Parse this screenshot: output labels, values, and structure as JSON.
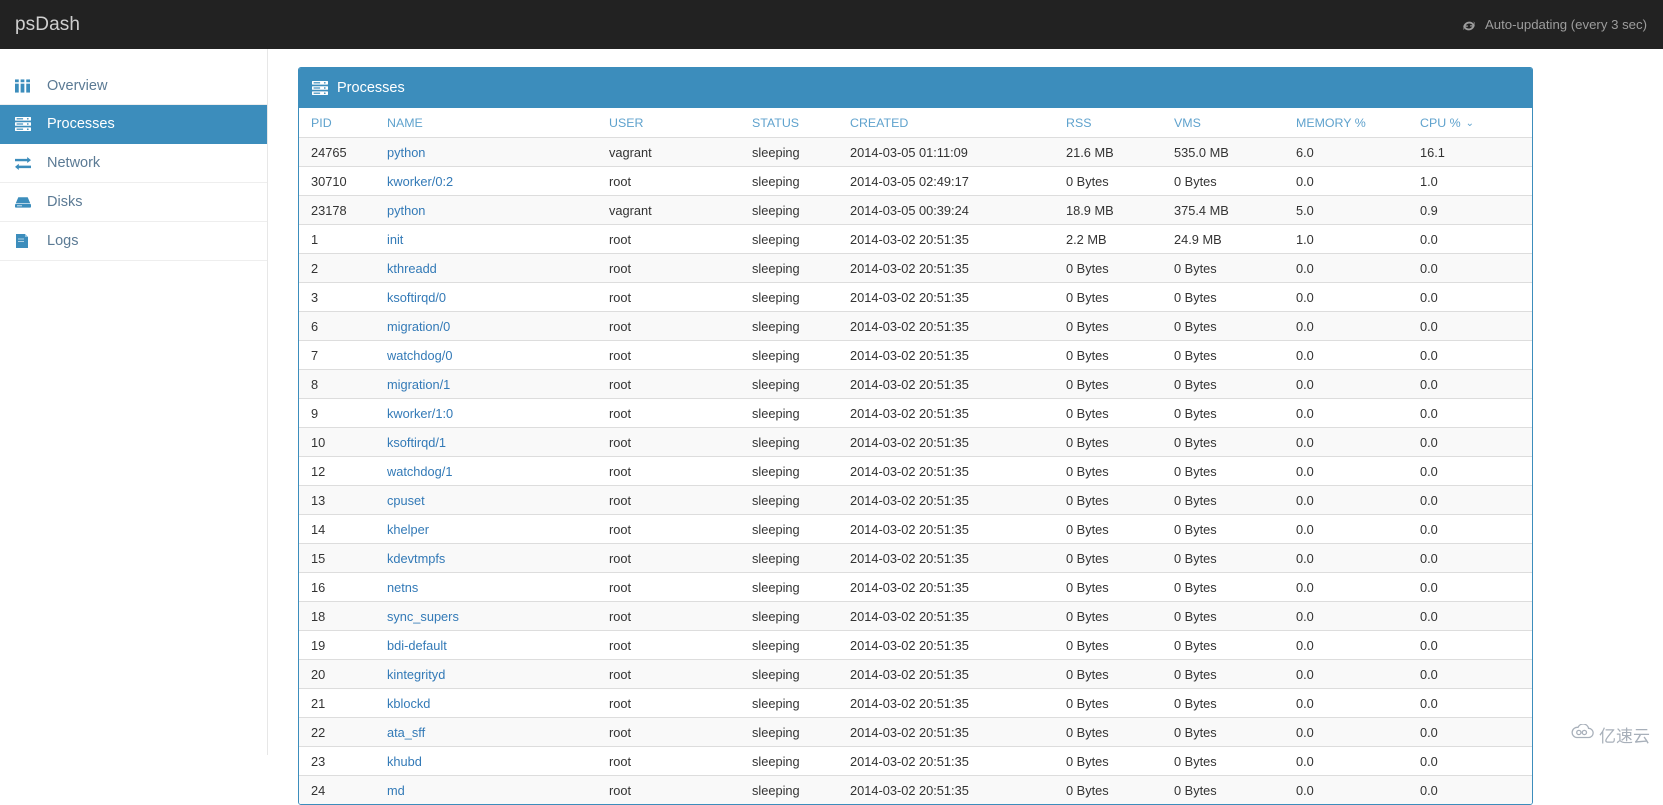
{
  "topbar": {
    "brand": "psDash",
    "refresh_icon": "refresh-icon",
    "auto_update_label": "Auto-updating (every 3 sec)"
  },
  "sidebar": {
    "items": [
      {
        "label": "Overview",
        "icon": "dashboard-grid-icon",
        "active": false
      },
      {
        "label": "Processes",
        "icon": "server-list-icon",
        "active": true
      },
      {
        "label": "Network",
        "icon": "exchange-arrows-icon",
        "active": false
      },
      {
        "label": "Disks",
        "icon": "hard-drive-icon",
        "active": false
      },
      {
        "label": "Logs",
        "icon": "book-icon",
        "active": false
      }
    ]
  },
  "panel": {
    "icon": "server-list-icon",
    "title": "Processes"
  },
  "table": {
    "columns": [
      {
        "key": "pid",
        "label": "PID",
        "sorted": false
      },
      {
        "key": "name",
        "label": "NAME",
        "sorted": false
      },
      {
        "key": "user",
        "label": "USER",
        "sorted": false
      },
      {
        "key": "status",
        "label": "STATUS",
        "sorted": false
      },
      {
        "key": "created",
        "label": "CREATED",
        "sorted": false
      },
      {
        "key": "rss",
        "label": "RSS",
        "sorted": false
      },
      {
        "key": "vms",
        "label": "VMS",
        "sorted": false
      },
      {
        "key": "memory",
        "label": "MEMORY %",
        "sorted": false
      },
      {
        "key": "cpu",
        "label": "CPU %",
        "sorted": true,
        "sort_caret": "⌄",
        "sort_dir": "desc"
      }
    ],
    "rows": [
      {
        "pid": "24765",
        "name": "python",
        "user": "vagrant",
        "status": "sleeping",
        "created": "2014-03-05 01:11:09",
        "rss": "21.6 MB",
        "vms": "535.0 MB",
        "memory": "6.0",
        "cpu": "16.1"
      },
      {
        "pid": "30710",
        "name": "kworker/0:2",
        "user": "root",
        "status": "sleeping",
        "created": "2014-03-05 02:49:17",
        "rss": "0 Bytes",
        "vms": "0 Bytes",
        "memory": "0.0",
        "cpu": "1.0"
      },
      {
        "pid": "23178",
        "name": "python",
        "user": "vagrant",
        "status": "sleeping",
        "created": "2014-03-05 00:39:24",
        "rss": "18.9 MB",
        "vms": "375.4 MB",
        "memory": "5.0",
        "cpu": "0.9"
      },
      {
        "pid": "1",
        "name": "init",
        "user": "root",
        "status": "sleeping",
        "created": "2014-03-02 20:51:35",
        "rss": "2.2 MB",
        "vms": "24.9 MB",
        "memory": "1.0",
        "cpu": "0.0"
      },
      {
        "pid": "2",
        "name": "kthreadd",
        "user": "root",
        "status": "sleeping",
        "created": "2014-03-02 20:51:35",
        "rss": "0 Bytes",
        "vms": "0 Bytes",
        "memory": "0.0",
        "cpu": "0.0"
      },
      {
        "pid": "3",
        "name": "ksoftirqd/0",
        "user": "root",
        "status": "sleeping",
        "created": "2014-03-02 20:51:35",
        "rss": "0 Bytes",
        "vms": "0 Bytes",
        "memory": "0.0",
        "cpu": "0.0"
      },
      {
        "pid": "6",
        "name": "migration/0",
        "user": "root",
        "status": "sleeping",
        "created": "2014-03-02 20:51:35",
        "rss": "0 Bytes",
        "vms": "0 Bytes",
        "memory": "0.0",
        "cpu": "0.0"
      },
      {
        "pid": "7",
        "name": "watchdog/0",
        "user": "root",
        "status": "sleeping",
        "created": "2014-03-02 20:51:35",
        "rss": "0 Bytes",
        "vms": "0 Bytes",
        "memory": "0.0",
        "cpu": "0.0"
      },
      {
        "pid": "8",
        "name": "migration/1",
        "user": "root",
        "status": "sleeping",
        "created": "2014-03-02 20:51:35",
        "rss": "0 Bytes",
        "vms": "0 Bytes",
        "memory": "0.0",
        "cpu": "0.0"
      },
      {
        "pid": "9",
        "name": "kworker/1:0",
        "user": "root",
        "status": "sleeping",
        "created": "2014-03-02 20:51:35",
        "rss": "0 Bytes",
        "vms": "0 Bytes",
        "memory": "0.0",
        "cpu": "0.0"
      },
      {
        "pid": "10",
        "name": "ksoftirqd/1",
        "user": "root",
        "status": "sleeping",
        "created": "2014-03-02 20:51:35",
        "rss": "0 Bytes",
        "vms": "0 Bytes",
        "memory": "0.0",
        "cpu": "0.0"
      },
      {
        "pid": "12",
        "name": "watchdog/1",
        "user": "root",
        "status": "sleeping",
        "created": "2014-03-02 20:51:35",
        "rss": "0 Bytes",
        "vms": "0 Bytes",
        "memory": "0.0",
        "cpu": "0.0"
      },
      {
        "pid": "13",
        "name": "cpuset",
        "user": "root",
        "status": "sleeping",
        "created": "2014-03-02 20:51:35",
        "rss": "0 Bytes",
        "vms": "0 Bytes",
        "memory": "0.0",
        "cpu": "0.0"
      },
      {
        "pid": "14",
        "name": "khelper",
        "user": "root",
        "status": "sleeping",
        "created": "2014-03-02 20:51:35",
        "rss": "0 Bytes",
        "vms": "0 Bytes",
        "memory": "0.0",
        "cpu": "0.0"
      },
      {
        "pid": "15",
        "name": "kdevtmpfs",
        "user": "root",
        "status": "sleeping",
        "created": "2014-03-02 20:51:35",
        "rss": "0 Bytes",
        "vms": "0 Bytes",
        "memory": "0.0",
        "cpu": "0.0"
      },
      {
        "pid": "16",
        "name": "netns",
        "user": "root",
        "status": "sleeping",
        "created": "2014-03-02 20:51:35",
        "rss": "0 Bytes",
        "vms": "0 Bytes",
        "memory": "0.0",
        "cpu": "0.0"
      },
      {
        "pid": "18",
        "name": "sync_supers",
        "user": "root",
        "status": "sleeping",
        "created": "2014-03-02 20:51:35",
        "rss": "0 Bytes",
        "vms": "0 Bytes",
        "memory": "0.0",
        "cpu": "0.0"
      },
      {
        "pid": "19",
        "name": "bdi-default",
        "user": "root",
        "status": "sleeping",
        "created": "2014-03-02 20:51:35",
        "rss": "0 Bytes",
        "vms": "0 Bytes",
        "memory": "0.0",
        "cpu": "0.0"
      },
      {
        "pid": "20",
        "name": "kintegrityd",
        "user": "root",
        "status": "sleeping",
        "created": "2014-03-02 20:51:35",
        "rss": "0 Bytes",
        "vms": "0 Bytes",
        "memory": "0.0",
        "cpu": "0.0"
      },
      {
        "pid": "21",
        "name": "kblockd",
        "user": "root",
        "status": "sleeping",
        "created": "2014-03-02 20:51:35",
        "rss": "0 Bytes",
        "vms": "0 Bytes",
        "memory": "0.0",
        "cpu": "0.0"
      },
      {
        "pid": "22",
        "name": "ata_sff",
        "user": "root",
        "status": "sleeping",
        "created": "2014-03-02 20:51:35",
        "rss": "0 Bytes",
        "vms": "0 Bytes",
        "memory": "0.0",
        "cpu": "0.0"
      },
      {
        "pid": "23",
        "name": "khubd",
        "user": "root",
        "status": "sleeping",
        "created": "2014-03-02 20:51:35",
        "rss": "0 Bytes",
        "vms": "0 Bytes",
        "memory": "0.0",
        "cpu": "0.0"
      },
      {
        "pid": "24",
        "name": "md",
        "user": "root",
        "status": "sleeping",
        "created": "2014-03-02 20:51:35",
        "rss": "0 Bytes",
        "vms": "0 Bytes",
        "memory": "0.0",
        "cpu": "0.0"
      }
    ]
  },
  "watermark": {
    "text": "亿速云",
    "icon": "cloud-logo-icon"
  },
  "colors": {
    "navbar_bg": "#222222",
    "accent_blue": "#3c8dbc",
    "link_blue": "#337ab7",
    "header_text_blue": "#5fa2cd",
    "sidebar_label": "#5b7a94"
  }
}
